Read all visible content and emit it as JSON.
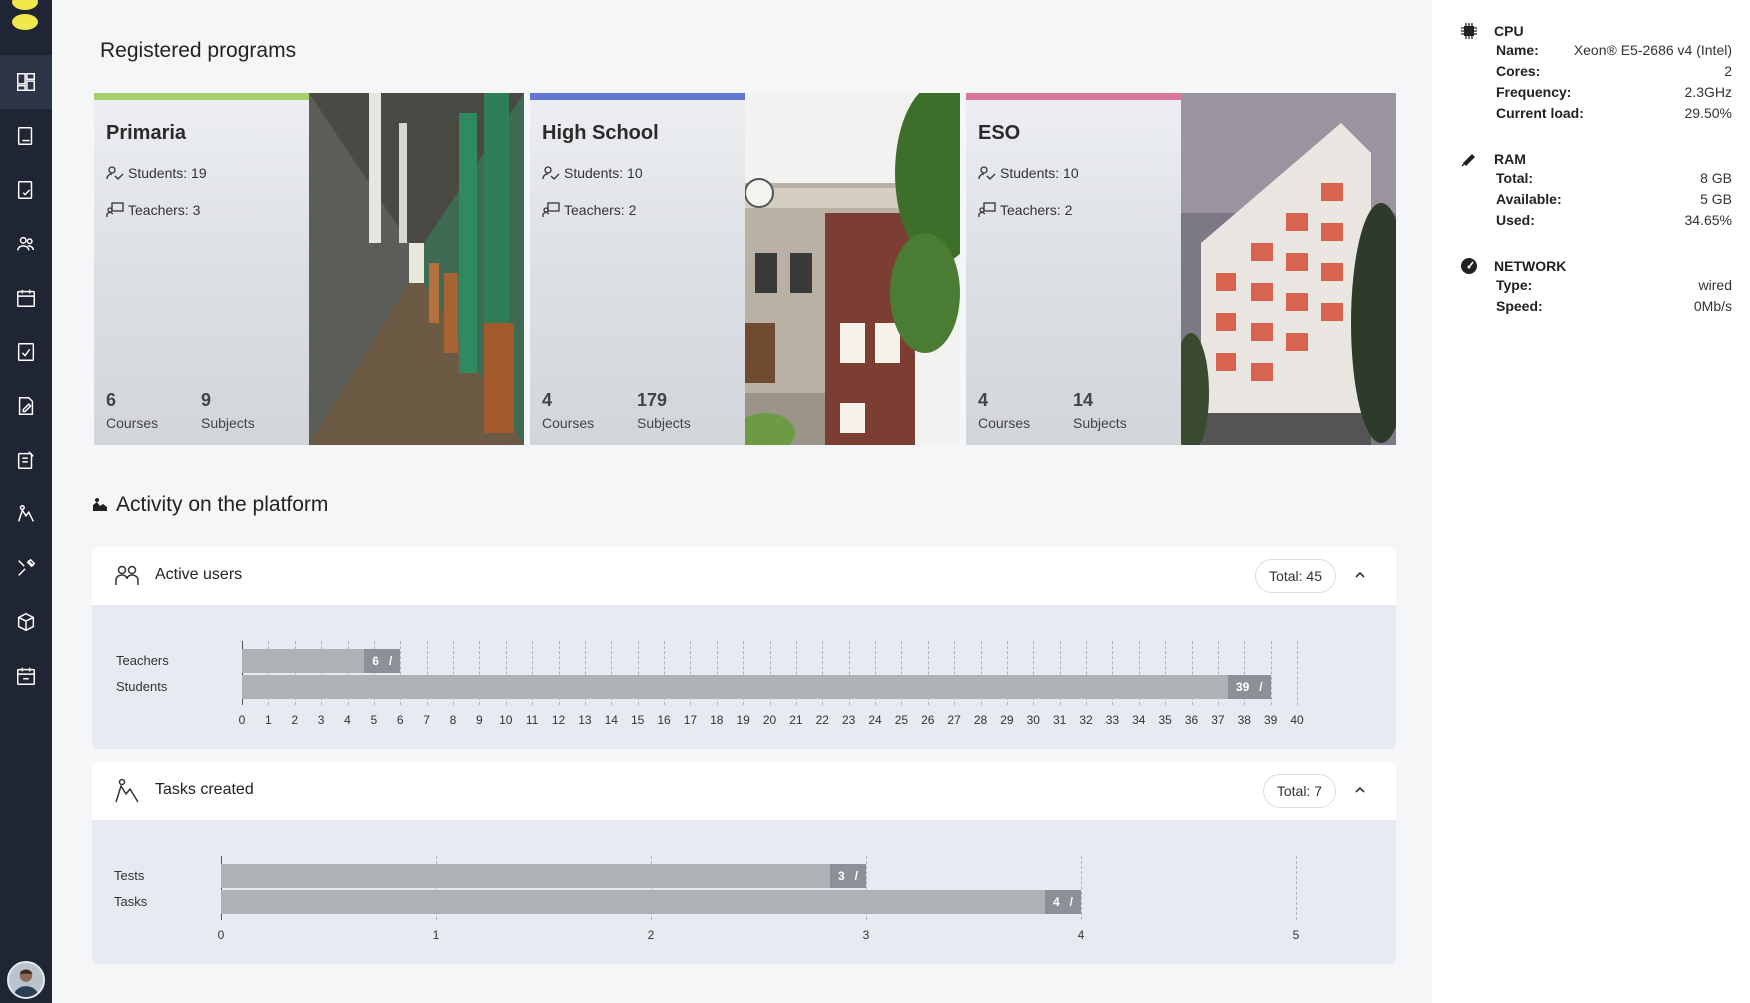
{
  "sidebar": {
    "items": [
      {
        "icon": "dashboard-icon",
        "active": true
      },
      {
        "icon": "document-icon"
      },
      {
        "icon": "document-check-icon"
      },
      {
        "icon": "users-icon"
      },
      {
        "icon": "calendar-icon"
      },
      {
        "icon": "checklist-icon"
      },
      {
        "icon": "edit-document-icon"
      },
      {
        "icon": "assignment-icon"
      },
      {
        "icon": "tasks-icon"
      },
      {
        "icon": "tools-icon"
      },
      {
        "icon": "box-icon"
      },
      {
        "icon": "schedule-icon"
      }
    ]
  },
  "page": {
    "title": "Registered programs"
  },
  "programs": [
    {
      "name": "Primaria",
      "students": "Students: 19",
      "teachers": "Teachers: 3",
      "courses_num": "6",
      "courses_label": "Courses",
      "subjects_num": "9",
      "subjects_label": "Subjects",
      "accent": "#a7cf6a"
    },
    {
      "name": "High School",
      "students": "Students: 10",
      "teachers": "Teachers: 2",
      "courses_num": "4",
      "courses_label": "Courses",
      "subjects_num": "179",
      "subjects_label": "Subjects",
      "accent": "#6577d4"
    },
    {
      "name": "ESO",
      "students": "Students: 10",
      "teachers": "Teachers: 2",
      "courses_num": "4",
      "courses_label": "Courses",
      "subjects_num": "14",
      "subjects_label": "Subjects",
      "accent": "#d9789a"
    }
  ],
  "activity": {
    "title": "Activity on the platform",
    "active_users": {
      "title": "Active users",
      "total": "Total: 45"
    },
    "tasks_created": {
      "title": "Tasks created",
      "total": "Total: 7"
    }
  },
  "chart_data": [
    {
      "type": "bar",
      "orientation": "horizontal",
      "categories": [
        "Teachers",
        "Students"
      ],
      "values": [
        6,
        39
      ],
      "data_labels": [
        "6",
        "39"
      ],
      "xlim": [
        0,
        40
      ],
      "x_ticks": [
        "0",
        "1",
        "2",
        "3",
        "4",
        "5",
        "6",
        "7",
        "8",
        "9",
        "10",
        "11",
        "12",
        "13",
        "14",
        "15",
        "16",
        "17",
        "18",
        "19",
        "20",
        "21",
        "22",
        "23",
        "24",
        "25",
        "26",
        "27",
        "28",
        "29",
        "30",
        "31",
        "32",
        "33",
        "34",
        "35",
        "36",
        "37",
        "38",
        "39",
        "40"
      ],
      "grid": true
    },
    {
      "type": "bar",
      "orientation": "horizontal",
      "categories": [
        "Tests",
        "Tasks"
      ],
      "values": [
        3,
        4
      ],
      "data_labels": [
        "3",
        "4"
      ],
      "xlim": [
        0,
        5
      ],
      "x_ticks": [
        "0",
        "1",
        "2",
        "3",
        "4",
        "5"
      ],
      "grid": true
    }
  ],
  "system": {
    "cpu": {
      "title": "CPU",
      "rows": [
        {
          "k": "Name:",
          "v": "Xeon® E5-2686 v4 (Intel)"
        },
        {
          "k": "Cores:",
          "v": "2"
        },
        {
          "k": "Frequency:",
          "v": "2.3GHz"
        },
        {
          "k": "Current load:",
          "v": "29.50%"
        }
      ]
    },
    "ram": {
      "title": "RAM",
      "rows": [
        {
          "k": "Total:",
          "v": "8 GB"
        },
        {
          "k": "Available:",
          "v": "5 GB"
        },
        {
          "k": "Used:",
          "v": "34.65%"
        }
      ]
    },
    "network": {
      "title": "NETWORK",
      "rows": [
        {
          "k": "Type:",
          "v": "wired"
        },
        {
          "k": "Speed:",
          "v": "0Mb/s"
        }
      ]
    }
  }
}
